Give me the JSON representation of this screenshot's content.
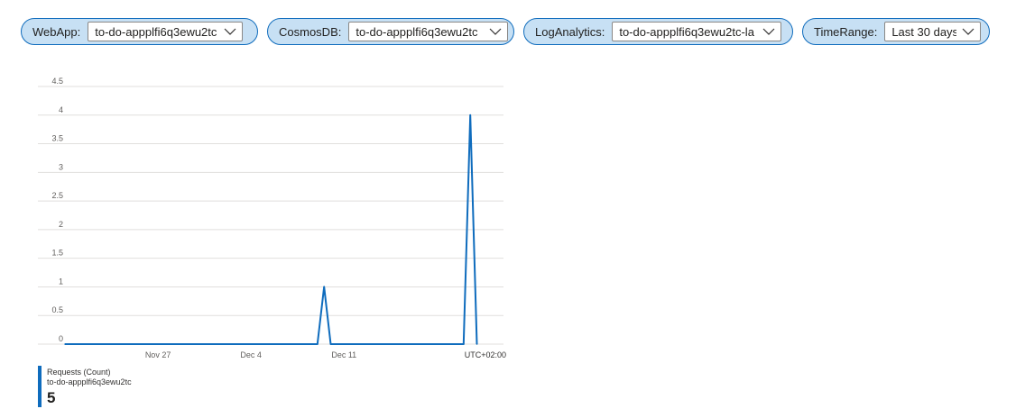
{
  "parameters": {
    "webapp": {
      "label": "WebApp:",
      "value": "to-do-appplfi6q3ewu2tc"
    },
    "cosmosdb": {
      "label": "CosmosDB:",
      "value": "to-do-appplfi6q3ewu2tc"
    },
    "loganalytics": {
      "label": "LogAnalytics:",
      "value": "to-do-appplfi6q3ewu2tc-la"
    },
    "timerange": {
      "label": "TimeRange:",
      "value": "Last 30 days"
    }
  },
  "icons": {
    "dropdown": "chevron-down-icon"
  },
  "colors": {
    "accent": "#0f6cbd",
    "pill_background": "#c7e0f4",
    "grid": "#e1dfdd"
  },
  "chart_data": {
    "type": "line",
    "title": "",
    "xlabel": "",
    "ylabel": "",
    "ylim": [
      0,
      4.5
    ],
    "yticks": [
      0,
      0.5,
      1,
      1.5,
      2,
      2.5,
      3,
      3.5,
      4,
      4.5
    ],
    "ytick_labels": [
      "0",
      "0.5",
      "1",
      "1.5",
      "2",
      "2.5",
      "3",
      "3.5",
      "4",
      "4.5"
    ],
    "xlim": [
      "2020-11-20",
      "2020-12-23"
    ],
    "xticks": [
      {
        "date": "2020-11-27",
        "label": "Nov 27"
      },
      {
        "date": "2020-12-04",
        "label": "Dec 4"
      },
      {
        "date": "2020-12-11",
        "label": "Dec 11"
      }
    ],
    "timezone_label": "UTC+02:00",
    "grid": true,
    "series": [
      {
        "name": "Requests (Count)",
        "resource": "to-do-appplfi6q3ewu2tc",
        "total": "5",
        "color": "#0f6cbd",
        "points": [
          {
            "x": "2020-11-20",
            "y": 0
          },
          {
            "x": "2020-12-09",
            "y": 0
          },
          {
            "x": "2020-12-09 12:00",
            "y": 1
          },
          {
            "x": "2020-12-10",
            "y": 0
          },
          {
            "x": "2020-12-20",
            "y": 0
          },
          {
            "x": "2020-12-20 12:00",
            "y": 4
          },
          {
            "x": "2020-12-21",
            "y": 0
          }
        ]
      }
    ]
  }
}
